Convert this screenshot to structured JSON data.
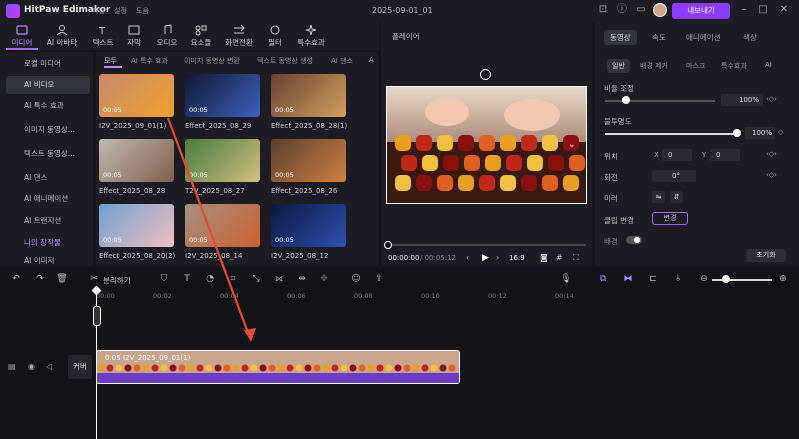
{
  "app": {
    "name": "HitPaw Edimakor",
    "menus": [
      "파일",
      "설정",
      "도움"
    ],
    "window_title": "2025-09-01_01",
    "export_label": "내보내기"
  },
  "toolbar": {
    "items": [
      "미디어",
      "AI 아바타",
      "텍스트",
      "자막",
      "오디오",
      "요소들",
      "화면전환",
      "필터",
      "특수효과"
    ]
  },
  "leftnav": {
    "items": [
      "로컬 미디어",
      "AI 비디오",
      "AI 특수 효과",
      "이미지 동영상...",
      "텍스트 동영상...",
      "AI 댄스",
      "AI 애니메이션",
      "AI 트랜지션",
      "나의 창작물",
      "AI 이미지"
    ]
  },
  "media": {
    "tabs": [
      "모두",
      "AI 특수 효과",
      "이미지 동영상 변환",
      "텍스트 동영상 생성",
      "AI 댄스",
      "A"
    ],
    "items": [
      {
        "name": "I2V_2025_09_01(1)",
        "duration": "00:05"
      },
      {
        "name": "Effect_2025_08_29",
        "duration": "00:05"
      },
      {
        "name": "Effect_2025_08_28(1)",
        "duration": "00:05"
      },
      {
        "name": "Effect_2025_08_28",
        "duration": "00:05"
      },
      {
        "name": "T2V_2025_08_27",
        "duration": "00:05"
      },
      {
        "name": "Effect_2025_08_26",
        "duration": "00:05"
      },
      {
        "name": "Effect_2025_08_20(2)",
        "duration": "00:05"
      },
      {
        "name": "I2V_2025_08_14",
        "duration": "00:05"
      },
      {
        "name": "I2V_2025_08_12",
        "duration": "00:05"
      }
    ]
  },
  "player": {
    "label": "플레이어",
    "current": "00:00:00",
    "total": "/ 00:05:12",
    "ratio": "16:9"
  },
  "properties": {
    "tabs": [
      "동영상",
      "속도",
      "애니메이션",
      "색상"
    ],
    "subtabs": [
      "일반",
      "배경 제거",
      "마스크",
      "특수효과",
      "AI"
    ],
    "scale_label": "비율 조정",
    "scale_value": "100%",
    "opacity_label": "불투명도",
    "opacity_value": "100%",
    "position_label": "위치",
    "x_label": "X",
    "x_value": "0",
    "y_label": "Y",
    "y_value": "0",
    "rotation_label": "회전",
    "rotation_value": "0°",
    "mirror_label": "미러",
    "clip_change_label": "클립 변경",
    "clip_change_button": "변경",
    "background_label": "배경",
    "reset_label": "초기화"
  },
  "timeline": {
    "split_label": "분리하기",
    "ruler": [
      "00:00",
      "00:02",
      "00:04",
      "00:06",
      "00:08",
      "00:10",
      "00:12",
      "00:14"
    ],
    "clip_label": "0:05 I2V_2025_09_01(1)",
    "cover_label": "커버"
  },
  "colors": {
    "accent": "#8b3dff",
    "bg": "#16161a",
    "panel": "#1c1c22"
  }
}
